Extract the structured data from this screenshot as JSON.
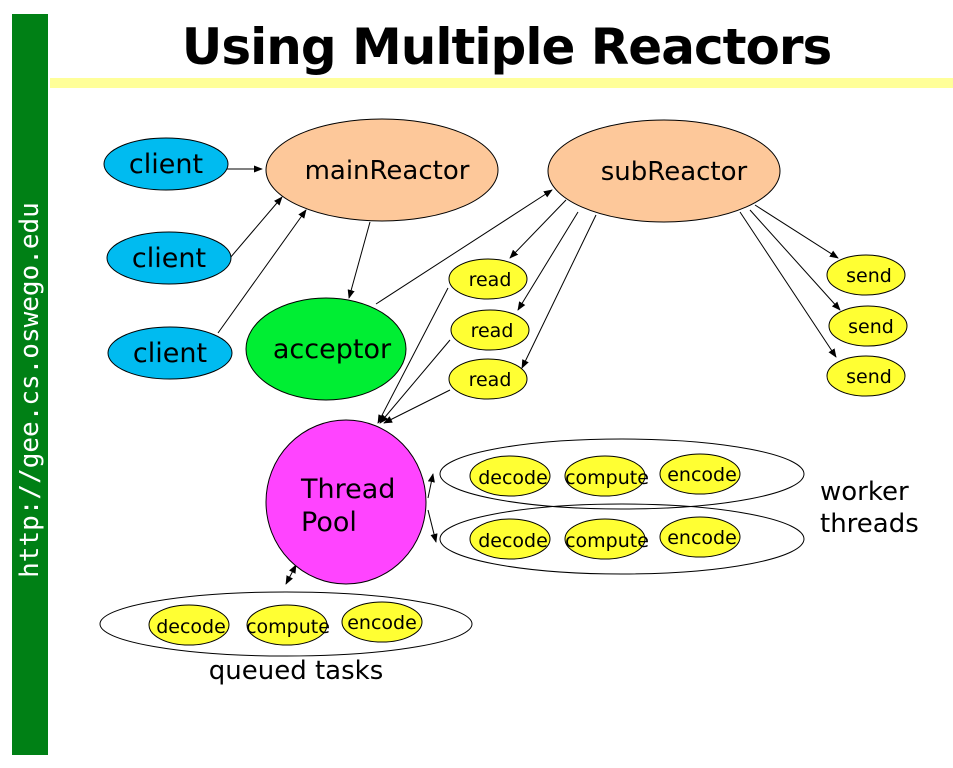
{
  "slide": {
    "title": "Using Multiple Reactors",
    "sidebar_url": "http://gee.cs.oswego.edu"
  },
  "colors": {
    "sidebar": "#008015",
    "title_underline": "#ffff99",
    "client": "#00bbf0",
    "reactor": "#fdc89a",
    "acceptor": "#00ee33",
    "task": "#ffff33",
    "thread_pool": "#ff44ff"
  },
  "nodes": {
    "clients": [
      "client",
      "client",
      "client"
    ],
    "main_reactor": "mainReactor",
    "sub_reactor": "subReactor",
    "acceptor": "acceptor",
    "reads": [
      "read",
      "read",
      "read"
    ],
    "sends": [
      "send",
      "send",
      "send"
    ],
    "thread_pool": [
      "Thread",
      "Pool"
    ],
    "worker_tasks": [
      [
        "decode",
        "compute",
        "encode"
      ],
      [
        "decode",
        "compute",
        "encode"
      ]
    ],
    "queued_tasks": [
      "decode",
      "compute",
      "encode"
    ]
  },
  "labels": {
    "worker_threads": [
      "worker",
      "threads"
    ],
    "queued_tasks": "queued tasks"
  }
}
